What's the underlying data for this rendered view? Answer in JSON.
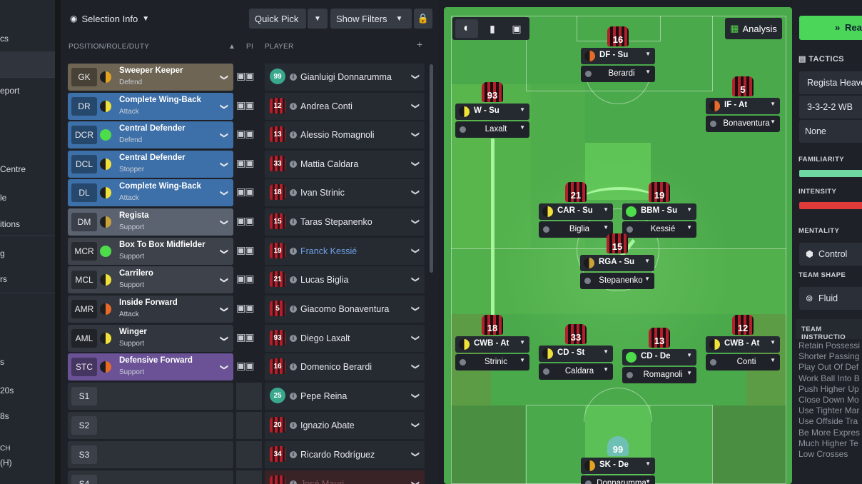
{
  "nav": {
    "items": [
      "cs",
      "eport",
      "Centre",
      "le",
      "itions",
      "g",
      "rs",
      "s",
      "20s",
      "8s",
      "CH",
      "(H)"
    ]
  },
  "toolbar": {
    "selection_info": "Selection Info",
    "quick_pick": "Quick Pick",
    "show_filters": "Show Filters"
  },
  "list": {
    "col_role": "POSITION/ROLE/DUTY",
    "col_pi": "PI",
    "col_player": "PLAYER",
    "rows": [
      {
        "pos": "GK",
        "role": "Sweeper Keeper",
        "duty": "Defend",
        "num": "99",
        "player": "Gianluigi Donnarumma",
        "color": "#6e6554",
        "dot": "duty-defend",
        "gk": true
      },
      {
        "pos": "DR",
        "role": "Complete Wing-Back",
        "duty": "Attack",
        "num": "12",
        "player": "Andrea Conti",
        "color": "#3d6fa8",
        "dot": "duty-attack"
      },
      {
        "pos": "DCR",
        "role": "Central Defender",
        "duty": "Defend",
        "num": "13",
        "player": "Alessio Romagnoli",
        "color": "#3d6fa8",
        "dot": "duty-green"
      },
      {
        "pos": "DCL",
        "role": "Central Defender",
        "duty": "Stopper",
        "num": "33",
        "player": "Mattia Caldara",
        "color": "#3d6fa8",
        "dot": "duty-attack"
      },
      {
        "pos": "DL",
        "role": "Complete Wing-Back",
        "duty": "Attack",
        "num": "18",
        "player": "Ivan Strinic",
        "color": "#3d6fa8",
        "dot": "duty-attack"
      },
      {
        "pos": "DM",
        "role": "Regista",
        "duty": "Support",
        "num": "15",
        "player": "Taras Stepanenko",
        "color": "#5b6270",
        "dot": "duty-support"
      },
      {
        "pos": "MCR",
        "role": "Box To Box Midfielder",
        "duty": "Support",
        "num": "19",
        "player": "Franck Kessié",
        "color": "#3e434b",
        "dot": "duty-green",
        "highlight": true
      },
      {
        "pos": "MCL",
        "role": "Carrilero",
        "duty": "Support",
        "num": "21",
        "player": "Lucas Biglia",
        "color": "#3e434b",
        "dot": "duty-attack"
      },
      {
        "pos": "AMR",
        "role": "Inside Forward",
        "duty": "Attack",
        "num": "5",
        "player": "Giacomo Bonaventura",
        "color": "#32363e",
        "dot": "duty-orange"
      },
      {
        "pos": "AML",
        "role": "Winger",
        "duty": "Support",
        "num": "93",
        "player": "Diego Laxalt",
        "color": "#32363e",
        "dot": "duty-attack"
      },
      {
        "pos": "STC",
        "role": "Defensive Forward",
        "duty": "Support",
        "num": "16",
        "player": "Domenico Berardi",
        "color": "#6b5296",
        "dot": "duty-orange"
      }
    ],
    "subs": [
      {
        "pos": "S1",
        "num": "25",
        "player": "Pepe Reina",
        "gk": true
      },
      {
        "pos": "S2",
        "num": "20",
        "player": "Ignazio Abate"
      },
      {
        "pos": "S3",
        "num": "34",
        "player": "Ricardo Rodríguez"
      },
      {
        "pos": "S4",
        "num": "",
        "player": "José Mauri"
      }
    ]
  },
  "pitch": {
    "analysis": "Analysis",
    "players": [
      {
        "num": "16",
        "role": "DF - Su",
        "player": "Berardi",
        "dot": "duty-orange"
      },
      {
        "num": "93",
        "role": "W - Su",
        "player": "Laxalt",
        "dot": "duty-attack"
      },
      {
        "num": "5",
        "role": "IF - At",
        "player": "Bonaventura",
        "dot": "duty-orange"
      },
      {
        "num": "21",
        "role": "CAR - Su",
        "player": "Biglia",
        "dot": "duty-attack"
      },
      {
        "num": "19",
        "role": "BBM - Su",
        "player": "Kessié",
        "dot": "duty-green"
      },
      {
        "num": "15",
        "role": "RGA - Su",
        "player": "Stepanenko",
        "dot": "duty-support"
      },
      {
        "num": "18",
        "role": "CWB - At",
        "player": "Strinic",
        "dot": "duty-attack"
      },
      {
        "num": "33",
        "role": "CD - St",
        "player": "Caldara",
        "dot": "duty-attack"
      },
      {
        "num": "13",
        "role": "CD - De",
        "player": "Romagnoli",
        "dot": "duty-green"
      },
      {
        "num": "12",
        "role": "CWB - At",
        "player": "Conti",
        "dot": "duty-attack"
      },
      {
        "num": "99",
        "role": "SK - De",
        "player": "Donnarumma",
        "dot": "duty-defend"
      }
    ]
  },
  "right": {
    "ready_label": "Rea",
    "tactics_label": "TACTICS",
    "tactic_name": "Regista Heave",
    "formation": "3-3-2-2 WB",
    "none": "None",
    "familiarity": "FAMILIARITY",
    "intensity": "INTENSITY",
    "mentality": "MENTALITY",
    "mentality_value": "Control",
    "team_shape": "TEAM SHAPE",
    "shape_value": "Fluid",
    "team_instructions": "TEAM INSTRUCTIO",
    "instructions": [
      "Retain Possessi",
      "Shorter Passing",
      "Play Out Of Def",
      "Work Ball Into B",
      "Push Higher Up",
      "Close Down Mo",
      "Use Tighter Mar",
      "Use Offside Tra",
      "Be More Expres",
      "Much Higher Te",
      "Low Crosses"
    ]
  },
  "colors": {
    "duty-defend": "#e3a320",
    "duty-attack": "#f0e03a",
    "duty-green": "#4ddc4a",
    "duty-support": "#c9a23a",
    "duty-orange": "#e86a2a",
    "pitch": "#4aa94a"
  }
}
